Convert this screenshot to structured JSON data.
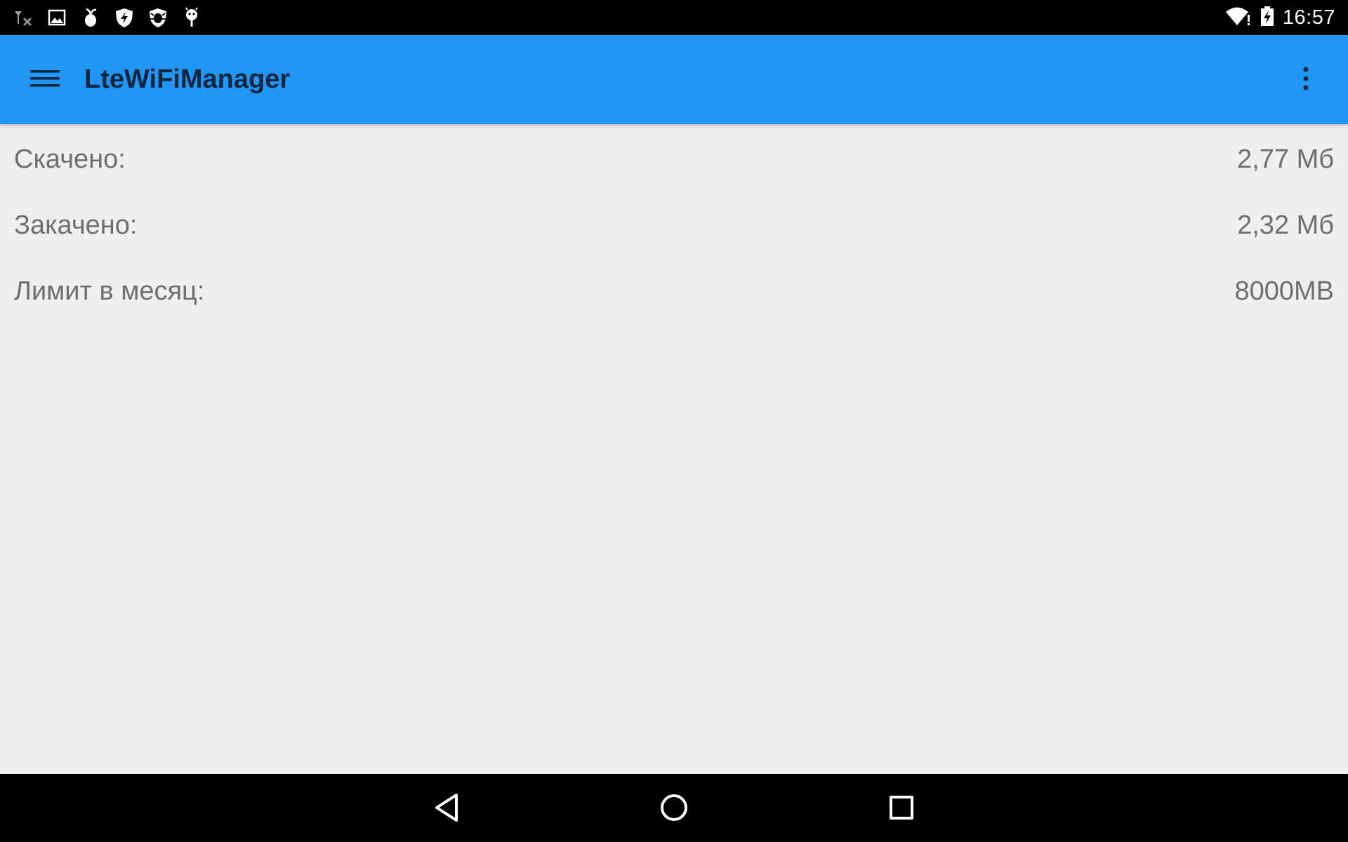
{
  "status_bar": {
    "time": "16:57",
    "left_icons": [
      "no-signal-icon",
      "image-icon",
      "fruit-icon",
      "shield-bolt-icon",
      "shield-bug-icon",
      "android-pin-icon"
    ],
    "right_icons": [
      "wifi-alert-icon",
      "battery-charging-icon"
    ]
  },
  "app_bar": {
    "title": "LteWiFiManager",
    "menu_icon": "hamburger-menu-icon",
    "overflow_icon": "more-vert-icon",
    "color": "#2196F3"
  },
  "stats": [
    {
      "label": "Скачено:",
      "value": "2,77 Мб"
    },
    {
      "label": "Закачено:",
      "value": "2,32 Мб"
    },
    {
      "label": "Лимит в месяц:",
      "value": "8000MB"
    }
  ],
  "nav_bar": {
    "back_icon": "back-triangle-icon",
    "home_icon": "home-circle-icon",
    "recents_icon": "recents-square-icon"
  }
}
